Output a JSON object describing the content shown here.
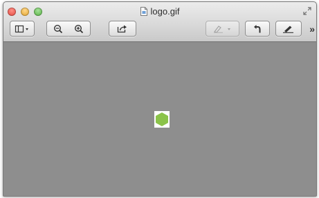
{
  "window": {
    "title": "logo.gif",
    "title_icon": "document-icon"
  },
  "toolbar": {
    "buttons": [
      {
        "name": "sidebar-view-button",
        "icon": "sidebar-icon",
        "has_dropdown": true
      },
      {
        "name": "zoom-out-button",
        "icon": "zoom-out-icon"
      },
      {
        "name": "zoom-in-button",
        "icon": "zoom-in-icon"
      },
      {
        "name": "share-button",
        "icon": "share-icon"
      },
      {
        "name": "markup-button",
        "icon": "highlight-icon",
        "has_dropdown": true,
        "enabled": false
      },
      {
        "name": "rotate-button",
        "icon": "rotate-left-icon"
      },
      {
        "name": "edit-button",
        "icon": "pencil-icon"
      }
    ],
    "overflow_label": "»"
  },
  "canvas": {
    "background": "#8e8e8e",
    "image": {
      "shape": "hexagon",
      "color": "#8bc34a",
      "background": "#ffffff"
    }
  }
}
